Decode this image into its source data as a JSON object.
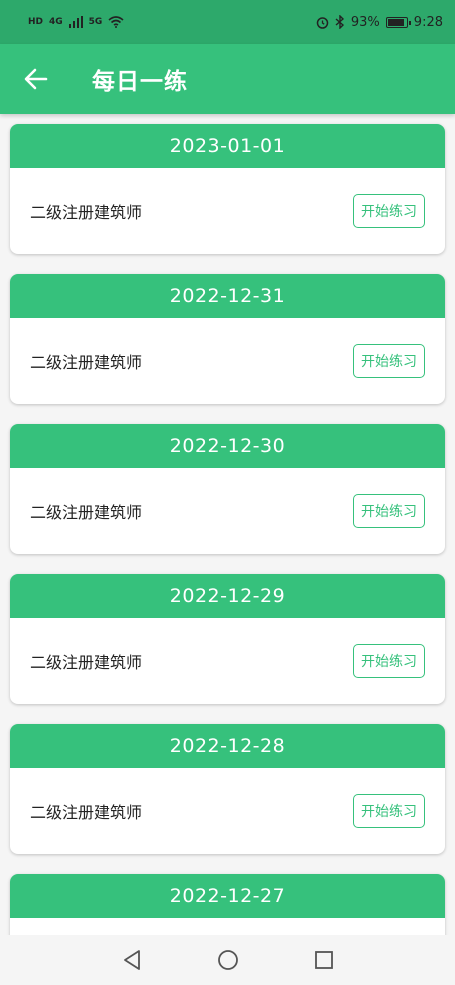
{
  "status_bar": {
    "left": "HD",
    "signal_4g": "4G",
    "signal_5g": "5G",
    "battery": "93%",
    "time": "9:28"
  },
  "header": {
    "title": "每日一练",
    "back_icon": "arrow-left-icon"
  },
  "practice_items": [
    {
      "date": "2023-01-01",
      "subject": "二级注册建筑师",
      "button": "开始练习"
    },
    {
      "date": "2022-12-31",
      "subject": "二级注册建筑师",
      "button": "开始练习"
    },
    {
      "date": "2022-12-30",
      "subject": "二级注册建筑师",
      "button": "开始练习"
    },
    {
      "date": "2022-12-29",
      "subject": "二级注册建筑师",
      "button": "开始练习"
    },
    {
      "date": "2022-12-28",
      "subject": "二级注册建筑师",
      "button": "开始练习"
    },
    {
      "date": "2022-12-27",
      "subject": "",
      "button": ""
    }
  ],
  "colors": {
    "primary": "#36c17c",
    "status_bar": "#2da96b",
    "background": "#f5f5f5"
  }
}
